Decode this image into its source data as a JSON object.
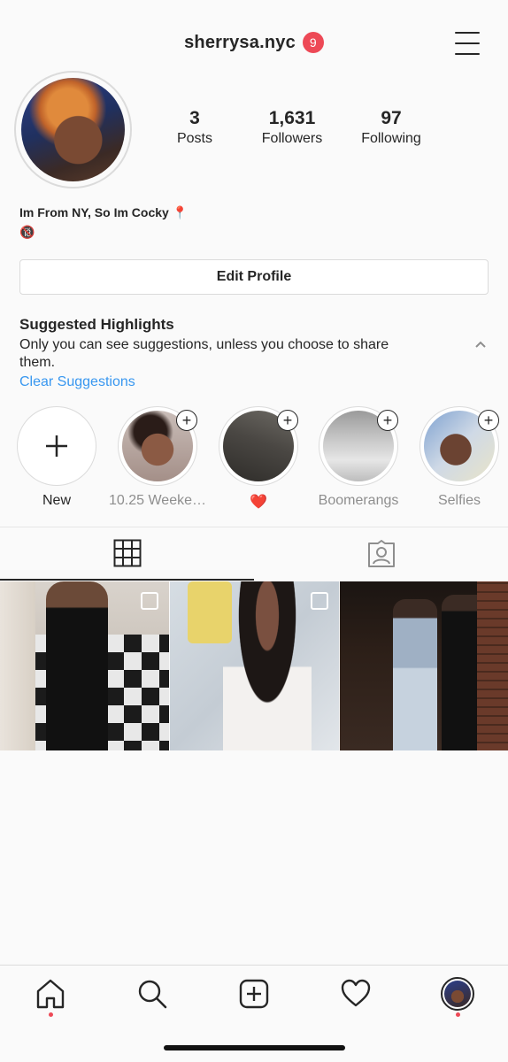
{
  "header": {
    "username": "sherrysa.nyc",
    "notification_count": "9"
  },
  "profile": {
    "stats": [
      {
        "value": "3",
        "label": "Posts"
      },
      {
        "value": "1,631",
        "label": "Followers"
      },
      {
        "value": "97",
        "label": "Following"
      }
    ],
    "bio_line1": "Im From NY, So Im Cocky 📍",
    "bio_line2": "🔞"
  },
  "edit_profile_label": "Edit Profile",
  "suggested": {
    "title": "Suggested Highlights",
    "description": "Only you can see suggestions, unless you choose to share them.",
    "clear_label": "Clear Suggestions"
  },
  "highlights": [
    {
      "label": "New"
    },
    {
      "label": "10.25 Weekend"
    },
    {
      "label": "❤️"
    },
    {
      "label": "Boomerangs"
    },
    {
      "label": "Selfies"
    }
  ],
  "colors": {
    "accent": "#3897f0",
    "badge": "#ed4956",
    "text": "#262626",
    "muted": "#8e8e8e"
  },
  "icons": [
    "menu-icon",
    "grid-icon",
    "tagged-icon",
    "home-icon",
    "search-icon",
    "add-post-icon",
    "heart-icon",
    "profile-avatar-icon"
  ]
}
